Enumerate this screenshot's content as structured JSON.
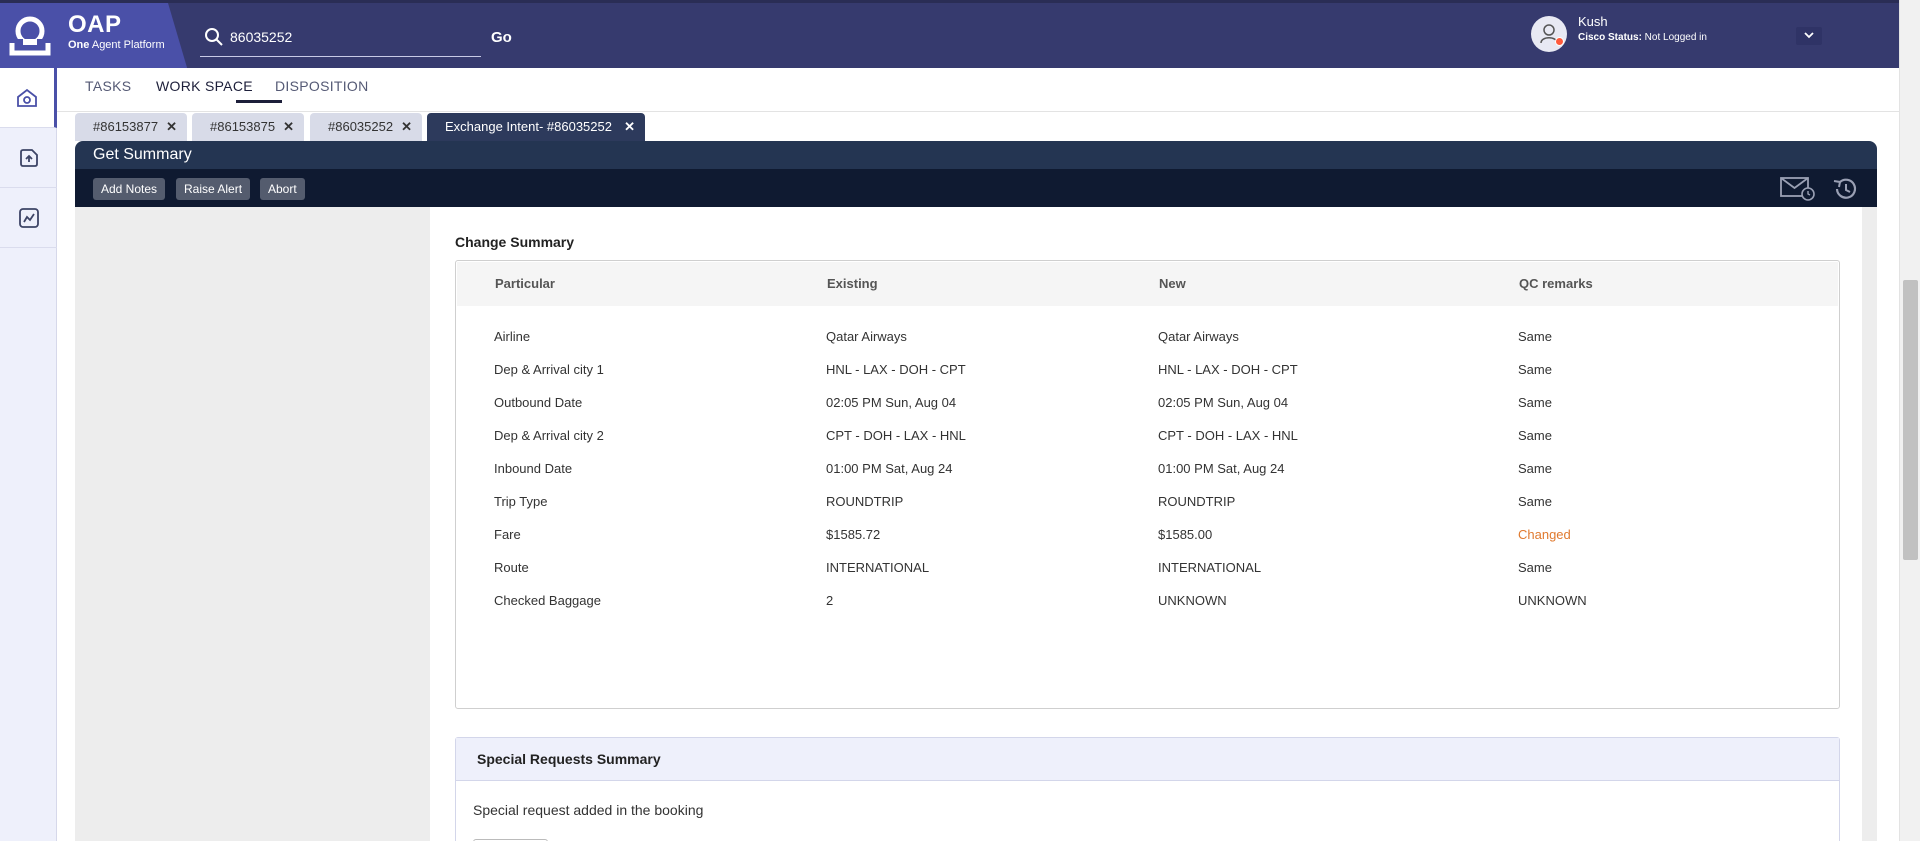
{
  "app": {
    "logo_text": "OAP",
    "subtitle_bold": "One",
    "subtitle_rest": " Agent Platform"
  },
  "search": {
    "value": "86035252",
    "go_label": "Go"
  },
  "user": {
    "name": "Kush",
    "status_label": "Cisco Status:",
    "status_value": " Not Logged in"
  },
  "nav": {
    "tabs": [
      "TASKS",
      "WORK SPACE",
      "DISPOSITION"
    ],
    "active": "WORK SPACE"
  },
  "case_tabs": [
    {
      "label": "#86153877",
      "close": "✕"
    },
    {
      "label": "#86153875",
      "close": "✕"
    },
    {
      "label": "#86035252",
      "close": "✕"
    },
    {
      "label": "Exchange Intent- #86035252",
      "close": "✕"
    }
  ],
  "summary": {
    "title": "Get Summary",
    "actions": [
      "Add Notes",
      "Raise Alert",
      "Abort"
    ]
  },
  "change_summary": {
    "title": "Change Summary",
    "columns": [
      "Particular",
      "Existing",
      "New",
      "QC remarks"
    ],
    "rows": [
      [
        "Airline",
        "Qatar Airways",
        "Qatar Airways",
        "Same"
      ],
      [
        "Dep & Arrival city 1",
        "HNL - LAX - DOH - CPT",
        "HNL - LAX - DOH - CPT",
        "Same"
      ],
      [
        "Outbound Date",
        "02:05 PM Sun, Aug 04",
        "02:05 PM Sun, Aug 04",
        "Same"
      ],
      [
        "Dep & Arrival city 2",
        "CPT - DOH - LAX - HNL",
        "CPT - DOH - LAX - HNL",
        "Same"
      ],
      [
        "Inbound Date",
        "01:00 PM Sat, Aug 24",
        "01:00 PM Sat, Aug 24",
        "Same"
      ],
      [
        "Trip Type",
        "ROUNDTRIP",
        "ROUNDTRIP",
        "Same"
      ],
      [
        "Fare",
        "$1585.72",
        "$1585.00",
        "Changed"
      ],
      [
        "Route",
        "INTERNATIONAL",
        "INTERNATIONAL",
        "Same"
      ],
      [
        "Checked Baggage",
        "2",
        "UNKNOWN",
        "UNKNOWN"
      ]
    ]
  },
  "special_requests": {
    "title": "Special Requests Summary",
    "text": "Special request added in the booking"
  },
  "colors": {
    "topbar": "#363a6e",
    "brand": "#4a50a8",
    "changed": "#e07a2f",
    "summary_header": "#243552"
  },
  "icons": {
    "rail": [
      "home-icon",
      "upload-icon",
      "analytics-icon"
    ],
    "toolbar": [
      "mail-clock-icon",
      "history-icon"
    ]
  }
}
